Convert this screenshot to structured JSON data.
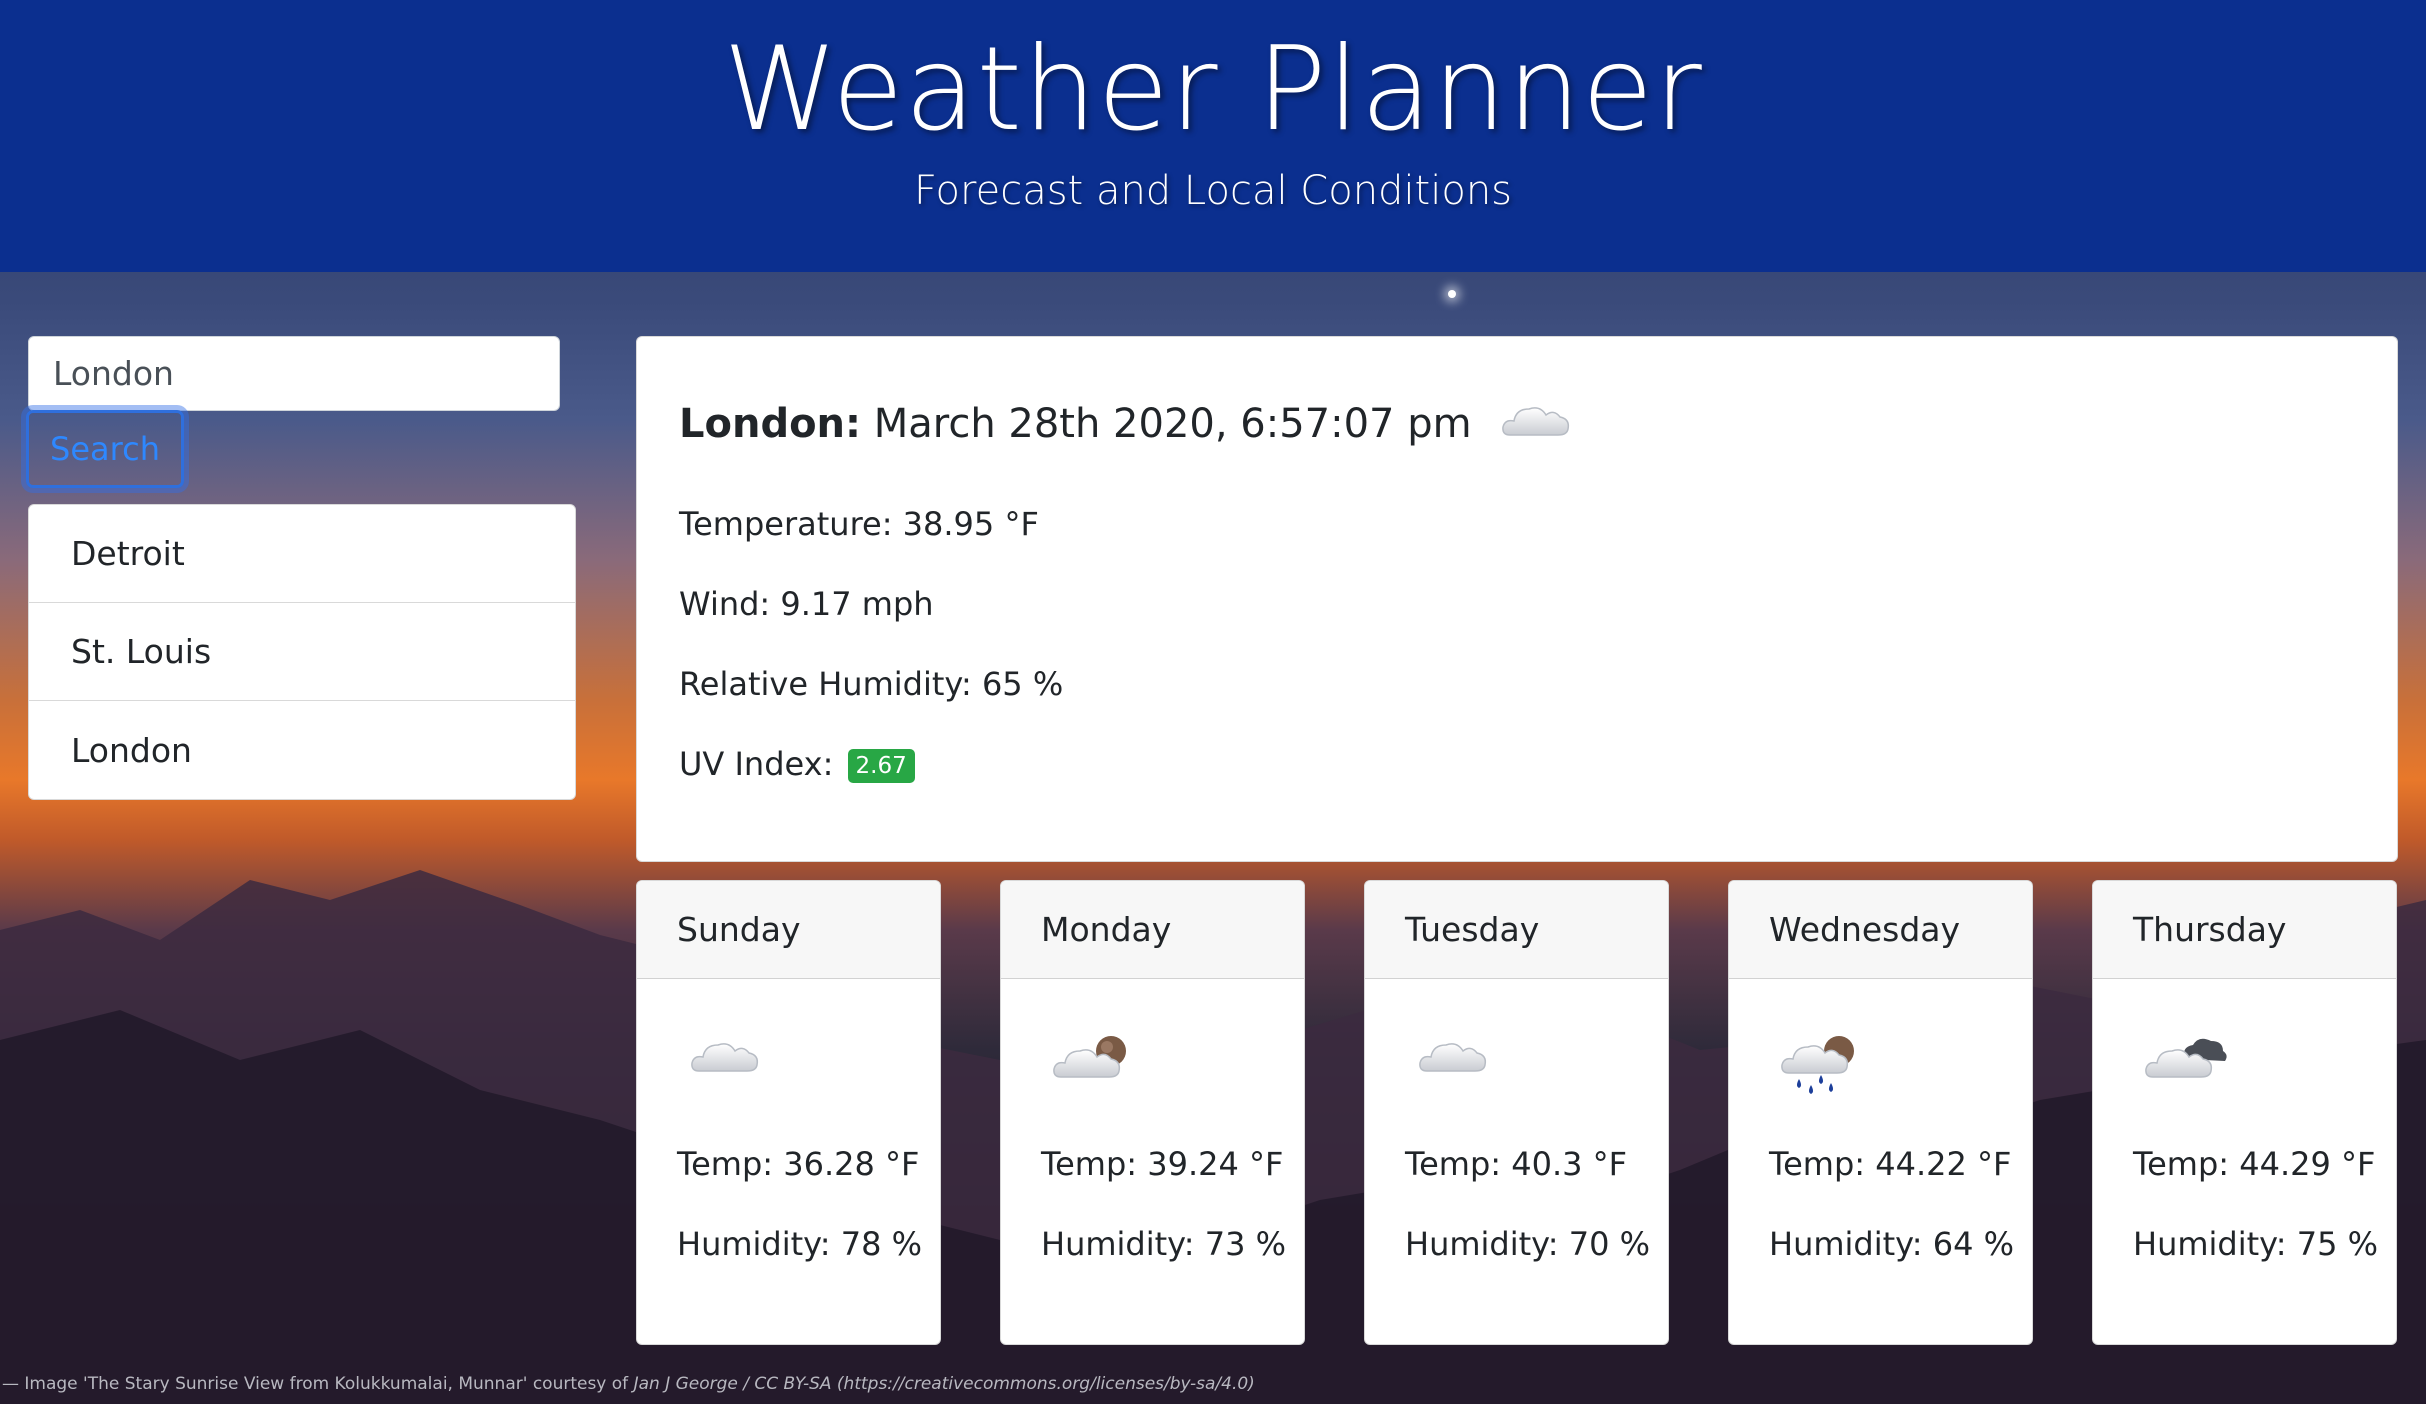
{
  "header": {
    "title": "Weather Planner",
    "subtitle": "Forecast and Local Conditions",
    "background": "#0b2f8f"
  },
  "search": {
    "value": "London",
    "button_label": "Search"
  },
  "history": [
    "Detroit",
    "St. Louis",
    "London"
  ],
  "current": {
    "city": "London:",
    "datetime": "March 28th 2020, 6:57:07 pm",
    "icon": "cloud-icon",
    "temperature": "Temperature: 38.95 °F",
    "wind": "Wind: 9.17 mph",
    "humidity": "Relative Humidity: 65 %",
    "uv_label": "UV Index:",
    "uv_value": "2.67",
    "uv_color": "#28a745"
  },
  "forecast": [
    {
      "day": "Sunday",
      "icon": "cloud-icon",
      "temp": "Temp: 36.28 °F",
      "humidity": "Humidity: 78 %"
    },
    {
      "day": "Monday",
      "icon": "partly-cloudy-icon",
      "temp": "Temp: 39.24 °F",
      "humidity": "Humidity: 73 %"
    },
    {
      "day": "Tuesday",
      "icon": "cloud-icon",
      "temp": "Temp: 40.3 °F",
      "humidity": "Humidity: 70 %"
    },
    {
      "day": "Wednesday",
      "icon": "rain-icon",
      "temp": "Temp: 44.22 °F",
      "humidity": "Humidity: 64 %"
    },
    {
      "day": "Thursday",
      "icon": "broken-clouds-icon",
      "temp": "Temp: 44.29 °F",
      "humidity": "Humidity: 75 %"
    }
  ],
  "credit": {
    "text": "— Image 'The Stary Sunrise View from Kolukkumalai, Munnar' courtesy of ",
    "author": "Jan J George / CC BY-SA (https://creativecommons.org/licenses/by-sa/4.0)"
  }
}
